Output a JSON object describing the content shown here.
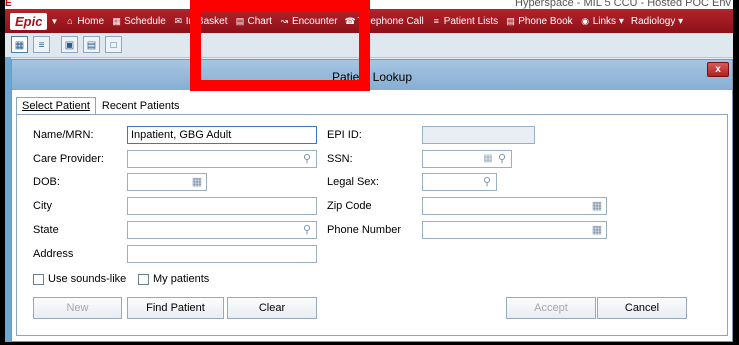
{
  "window": {
    "app_marker": "E",
    "title": "Hyperspace - MIL 5 CCU - Hosted POC Env"
  },
  "menubar": {
    "logo": "Epic",
    "items": [
      {
        "label": "Home",
        "icon": "home-icon"
      },
      {
        "label": "Schedule",
        "icon": "calendar-icon"
      },
      {
        "label": "In Basket",
        "icon": "inbox-icon"
      },
      {
        "label": "Chart",
        "icon": "folder-icon"
      },
      {
        "label": "Encounter",
        "icon": "encounter-icon"
      },
      {
        "label": "Telephone Call",
        "icon": "phone-icon"
      },
      {
        "label": "Patient Lists",
        "icon": "list-icon"
      },
      {
        "label": "Phone Book",
        "icon": "book-icon"
      },
      {
        "label": "Links",
        "icon": "globe-icon"
      },
      {
        "label": "Radiology",
        "icon": ""
      }
    ]
  },
  "toolbar": {
    "buttons": [
      "calendar-icon",
      "list-icon",
      "window-icon",
      "layout-icon",
      "chat-icon"
    ]
  },
  "dialog": {
    "title": "Patient Lookup",
    "close_label": "x",
    "tabs": [
      {
        "label": "Select Patient",
        "active": true
      },
      {
        "label": "Recent Patients",
        "active": false
      }
    ],
    "fields": {
      "name_mrn": {
        "label": "Name/MRN:",
        "value": "Inpatient, GBG Adult"
      },
      "care_provider": {
        "label": "Care Provider:",
        "value": ""
      },
      "dob": {
        "label": "DOB:",
        "value": ""
      },
      "city": {
        "label": "City",
        "value": ""
      },
      "state": {
        "label": "State",
        "value": ""
      },
      "address": {
        "label": "Address",
        "value": ""
      },
      "epi_id": {
        "label": "EPI ID:",
        "value": ""
      },
      "ssn": {
        "label": "SSN:",
        "value": ""
      },
      "legal_sex": {
        "label": "Legal Sex:",
        "value": ""
      },
      "zip_code": {
        "label": "Zip Code",
        "value": ""
      },
      "phone_number": {
        "label": "Phone Number",
        "value": ""
      }
    },
    "checkboxes": {
      "sounds_like": {
        "label": "Use sounds-like",
        "checked": false
      },
      "my_patients": {
        "label": "My patients",
        "checked": false
      }
    },
    "buttons": {
      "new": {
        "label": "New",
        "enabled": false
      },
      "find_patient": {
        "label": "Find Patient",
        "enabled": true
      },
      "clear": {
        "label": "Clear",
        "enabled": true
      },
      "accept": {
        "label": "Accept",
        "enabled": false
      },
      "cancel": {
        "label": "Cancel",
        "enabled": true
      }
    }
  },
  "colors": {
    "menubar": "#a11a22",
    "dialog_title": "#97bbde",
    "highlight": "#ff0000"
  }
}
